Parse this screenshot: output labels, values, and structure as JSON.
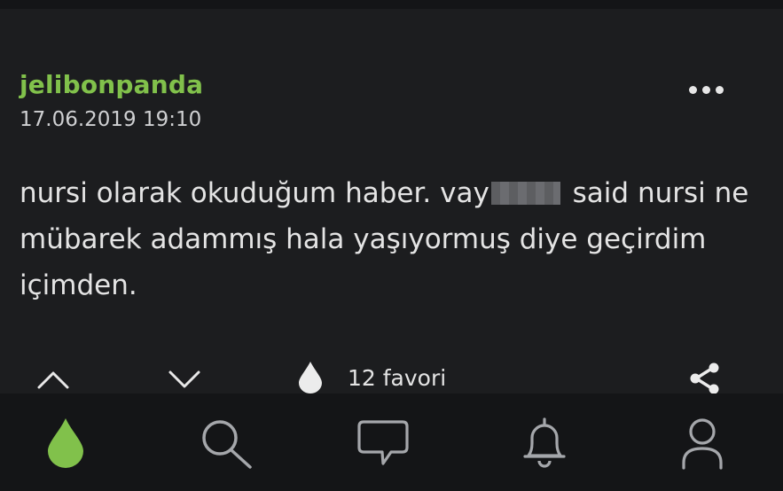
{
  "entry": {
    "author": "jelibonpanda",
    "datetime": "17.06.2019 19:10",
    "text_part1": "nursi olarak okuduğum haber. vay",
    "text_part2": "said nursi ne mübarek adammış hala yaşıyormuş diye geçirdim içimden.",
    "favorites_label": "12 favori"
  },
  "colors": {
    "background": "#1c1d1f",
    "nav_background": "#141517",
    "accent_green": "#81c14b",
    "text": "#e4e4e4"
  },
  "icons": {
    "more": "more-dots-icon",
    "upvote": "chevron-up-icon",
    "downvote": "chevron-down-icon",
    "favorite": "drop-icon",
    "share": "share-icon",
    "nav": [
      "drop-logo-icon",
      "search-icon",
      "message-icon",
      "bell-icon",
      "user-icon"
    ]
  }
}
